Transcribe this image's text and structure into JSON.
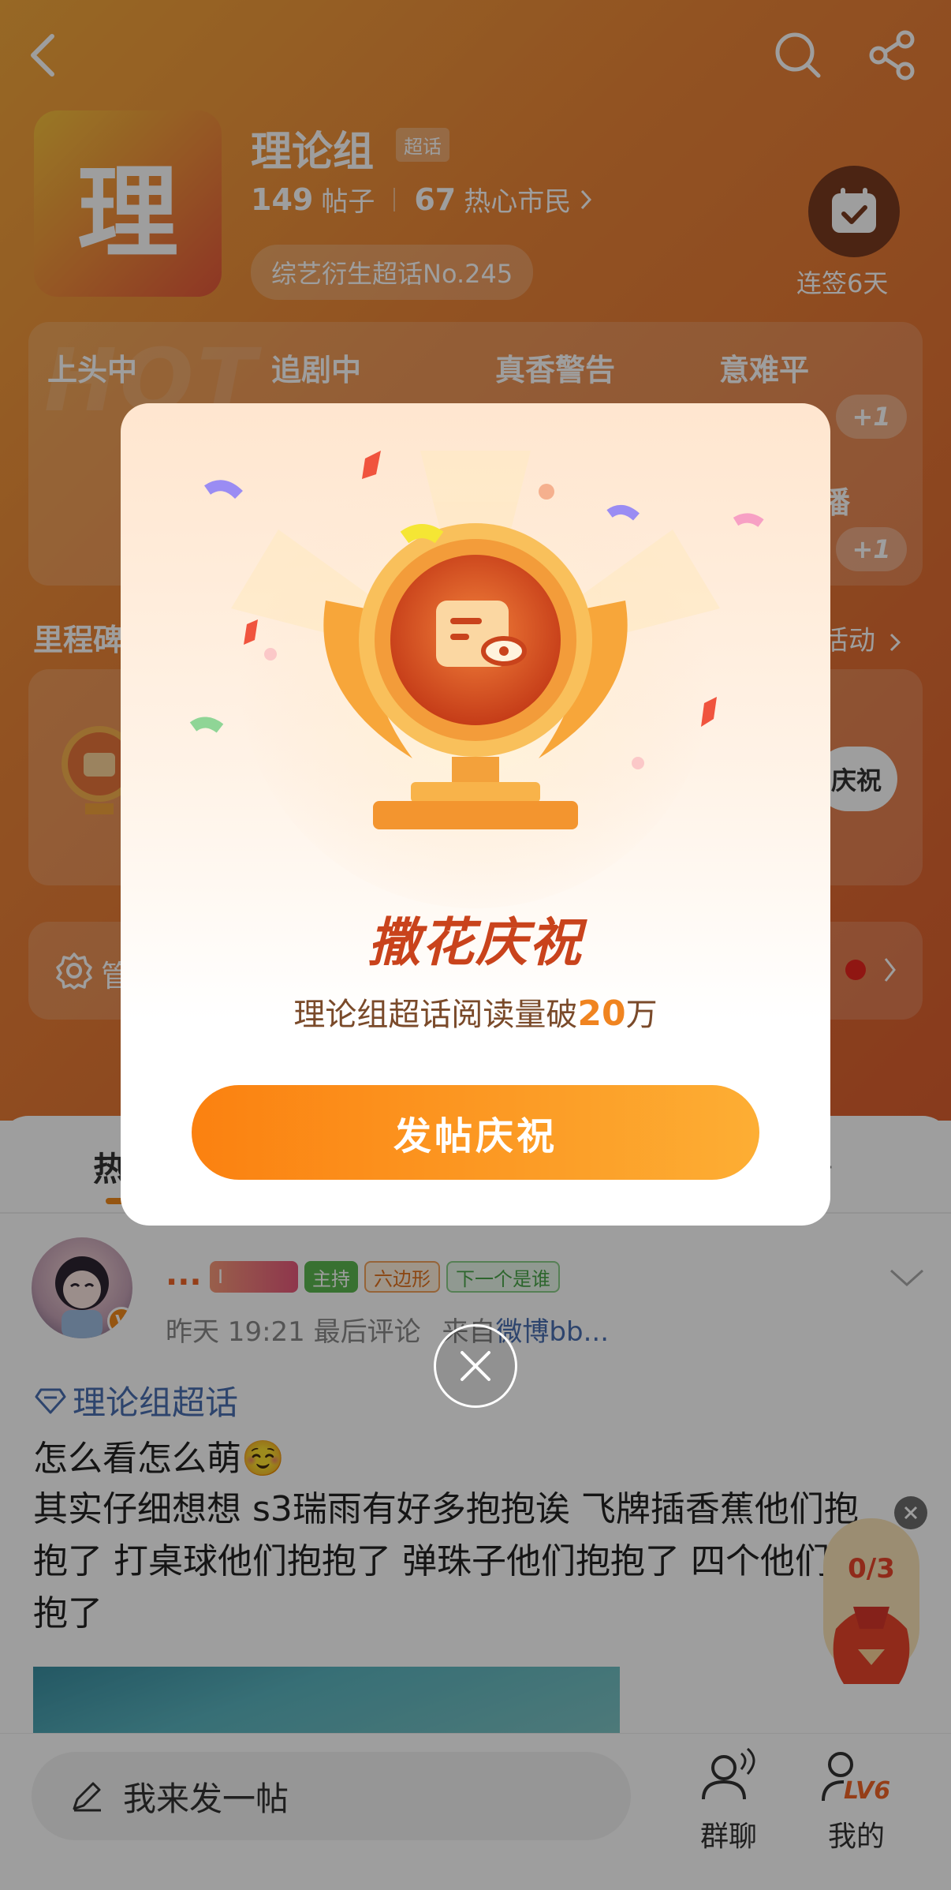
{
  "header": {
    "topic_title": "理论组",
    "topic_badge": "超话",
    "avatar_char": "理",
    "posts_count": "149",
    "posts_label": "帖子",
    "fans_count": "67",
    "fans_label": "热心市民",
    "rank_text": "综艺衍生超话No.245",
    "checkin_label": "连签6天",
    "hot_watermark": "HOT"
  },
  "tags": [
    {
      "label": "上头中"
    },
    {
      "label": "追剧中"
    },
    {
      "label": "真香警告"
    },
    {
      "label": "意难平"
    },
    {
      "label": "播"
    }
  ],
  "tag_plus": [
    "+1",
    "+1"
  ],
  "milestone": {
    "title": "里程碑",
    "link": "活动",
    "mini_button": "庆祝"
  },
  "manage": {
    "label": "管"
  },
  "feed": {
    "tab_left": "热",
    "tab_right": "册"
  },
  "post": {
    "username": "...",
    "level_badge": "I",
    "host_badge": "主持",
    "hex_badge": "六边形",
    "next_badge": "下一个是谁",
    "meta_time": "昨天 19:21 最后评论",
    "meta_from_prefix": "来自",
    "meta_source": "微博bb...",
    "topic_link": "理论组超话",
    "title": "怎么看怎么萌☺️",
    "body": "其实仔细想想 s3瑞雨有好多抱抱诶 飞牌插香蕉他们抱抱了 打桌球他们抱抱了 弹珠子他们抱抱了 四个他们抱抱了"
  },
  "reward": {
    "progress_text": "0/3"
  },
  "bottombar": {
    "compose_placeholder": "我来发一帖",
    "group_chat": "群聊",
    "mine": "我的",
    "level": "LV6"
  },
  "modal": {
    "title": "撒花庆祝",
    "desc_prefix": "理论组超话阅读量破",
    "desc_number": "20",
    "desc_suffix": "万",
    "button": "发帖庆祝"
  },
  "colors": {
    "brand_orange": "#fb8110",
    "hero_orange": "#ec8638",
    "link_blue": "#4a6fb0",
    "title_red": "#c9431c"
  },
  "icons": [
    "back-icon",
    "search-icon",
    "share-icon",
    "calendar-check-icon",
    "settings-icon",
    "chevron-right-icon",
    "chevron-down-icon",
    "diamond-icon",
    "pencil-icon",
    "group-chat-icon",
    "user-level-icon",
    "close-icon",
    "trophy-icon",
    "red-packet-icon"
  ]
}
